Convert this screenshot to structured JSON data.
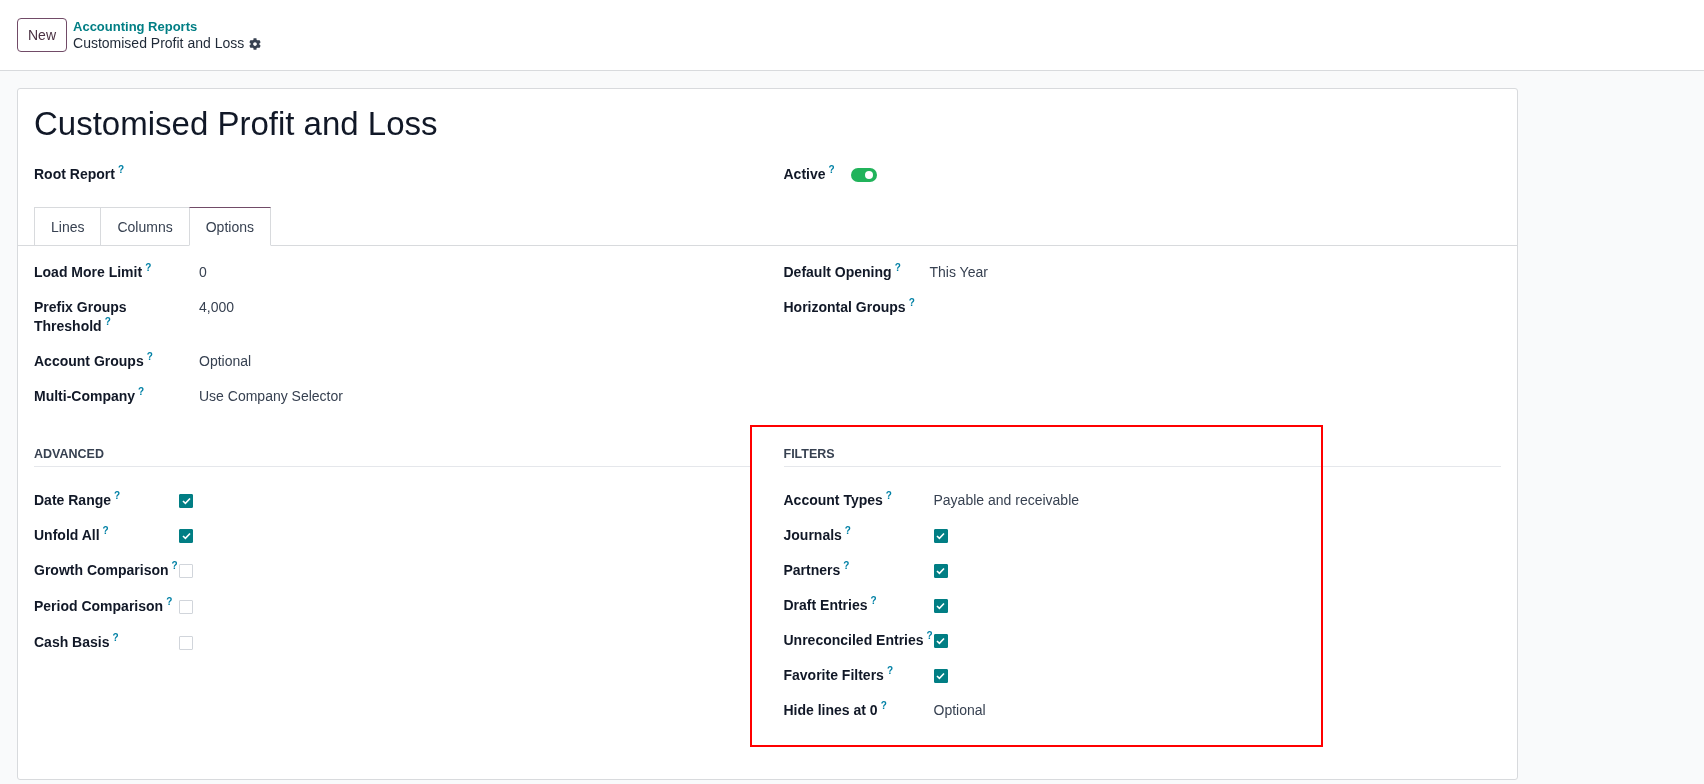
{
  "control_panel": {
    "new_button": "New",
    "breadcrumb": {
      "parent": "Accounting Reports",
      "current": "Customised Profit and Loss"
    }
  },
  "form": {
    "title": "Customised Profit and Loss",
    "root_report": {
      "label": "Root Report",
      "help": "?"
    },
    "active": {
      "label": "Active",
      "help": "?",
      "on": true
    },
    "tabs": [
      {
        "label": "Lines",
        "selected": false
      },
      {
        "label": "Columns",
        "selected": false
      },
      {
        "label": "Options",
        "selected": true
      }
    ],
    "options_left": [
      {
        "label": "Load More Limit",
        "help": "?",
        "value": "0"
      },
      {
        "label": "Prefix Groups Threshold",
        "help": "?",
        "value": "4,000"
      },
      {
        "label": "Account Groups",
        "help": "?",
        "value": "Optional"
      },
      {
        "label": "Multi-Company",
        "help": "?",
        "value": "Use Company Selector"
      }
    ],
    "options_right": [
      {
        "label": "Default Opening",
        "help": "?",
        "value": "This Year"
      },
      {
        "label": "Horizontal Groups",
        "help": "?"
      }
    ],
    "sections": [
      {
        "title": "ADVANCED",
        "highlighted": false,
        "fields": [
          {
            "label": "Date Range",
            "help": "?",
            "kind": "checkbox",
            "checked": true
          },
          {
            "label": "Unfold All",
            "help": "?",
            "kind": "checkbox",
            "checked": true
          },
          {
            "label": "Growth Comparison",
            "help": "?",
            "kind": "checkbox",
            "checked": false
          },
          {
            "label": "Period Comparison",
            "help": "?",
            "kind": "checkbox",
            "checked": false
          },
          {
            "label": "Cash Basis",
            "help": "?",
            "kind": "checkbox",
            "checked": false
          }
        ]
      },
      {
        "title": "FILTERS",
        "highlighted": true,
        "fields": [
          {
            "label": "Account Types",
            "help": "?",
            "kind": "text",
            "value": "Payable and receivable"
          },
          {
            "label": "Journals",
            "help": "?",
            "kind": "checkbox",
            "checked": true
          },
          {
            "label": "Partners",
            "help": "?",
            "kind": "checkbox",
            "checked": true
          },
          {
            "label": "Draft Entries",
            "help": "?",
            "kind": "checkbox",
            "checked": true
          },
          {
            "label": "Unreconciled Entries",
            "help": "?",
            "kind": "checkbox",
            "checked": true
          },
          {
            "label": "Favorite Filters",
            "help": "?",
            "kind": "checkbox",
            "checked": true
          },
          {
            "label": "Hide lines at 0",
            "help": "?",
            "kind": "text",
            "value": "Optional"
          }
        ]
      }
    ]
  }
}
